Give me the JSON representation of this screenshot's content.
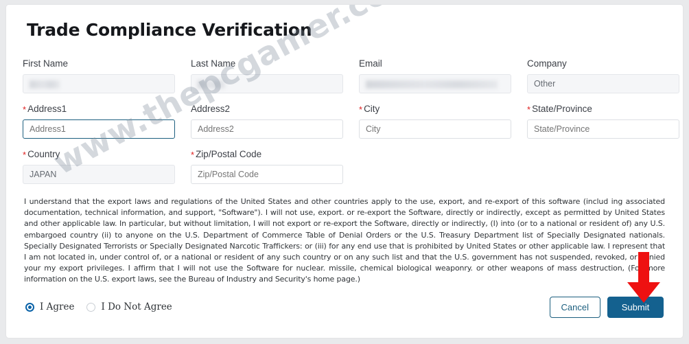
{
  "page": {
    "title": "Trade Compliance Verification",
    "watermark": "www.thepcgamer.com"
  },
  "form": {
    "rows": [
      [
        {
          "label": "First Name",
          "required": false,
          "value": "",
          "placeholder": "",
          "state": "readonly-blurred"
        },
        {
          "label": "Last Name",
          "required": false,
          "value": "",
          "placeholder": "",
          "state": "readonly-blurred"
        },
        {
          "label": "Email",
          "required": false,
          "value": "",
          "placeholder": "",
          "state": "readonly-blurred"
        },
        {
          "label": "Company",
          "required": false,
          "value": "Other",
          "placeholder": "",
          "state": "readonly"
        }
      ],
      [
        {
          "label": "Address1",
          "required": true,
          "value": "",
          "placeholder": "Address1",
          "state": "focused"
        },
        {
          "label": "Address2",
          "required": false,
          "value": "",
          "placeholder": "Address2",
          "state": "empty"
        },
        {
          "label": "City",
          "required": true,
          "value": "",
          "placeholder": "City",
          "state": "empty"
        },
        {
          "label": "State/Province",
          "required": true,
          "value": "",
          "placeholder": "State/Province",
          "state": "empty"
        }
      ],
      [
        {
          "label": "Country",
          "required": true,
          "value": "JAPAN",
          "placeholder": "",
          "state": "readonly"
        },
        {
          "label": "Zip/Postal Code",
          "required": true,
          "value": "",
          "placeholder": "Zip/Postal Code",
          "state": "empty"
        }
      ]
    ],
    "required_marker": "*"
  },
  "legal": {
    "text": "I understand that the export laws and regulations of the United States and other countries apply to the use, export, and re-export of this software (includ ing associated documentation, technical information, and support, \"Software\"). I will not use, export. or re-export the Software, directly or indirectly, except as permitted by United States and other applicable law. In particular, but without limitation, I will not export or re-export the Software, directly or indirectly, (I) into (or to a national or resident of) any U.S. embargoed country (ii) to anyone on the U.S. Department of Commerce Table of Denial Orders or the U.S. Treasury Department list of Specially Designated nationals. Specially Designated Terrorists  or Specially Designated Narcotic Traffickers: or (iii) for any end use that is prohibited by United States or other applicable law. I represent that I am not located in, under control of, or a national or resident of any such country or on any such list and that the U.S. government has not suspended, revoked, or denied your my export privileges. I affirm that I will not use the Software for nuclear. missile, chemical biological weaponry. or other weapons of mass destruction, (For more information on the U.S. export laws, see the Bureau of Industry and Security's home page.)"
  },
  "agreement": {
    "agree_label": "I Agree",
    "disagree_label": "I Do Not Agree",
    "selected": "agree"
  },
  "actions": {
    "cancel_label": "Cancel",
    "submit_label": "Submit"
  },
  "colors": {
    "submit_blue": "#14618f",
    "focus_border": "#1b5e7e",
    "required_red": "#e02020",
    "arrow_red": "#ee1111",
    "radio_blue": "#0b63a8"
  }
}
